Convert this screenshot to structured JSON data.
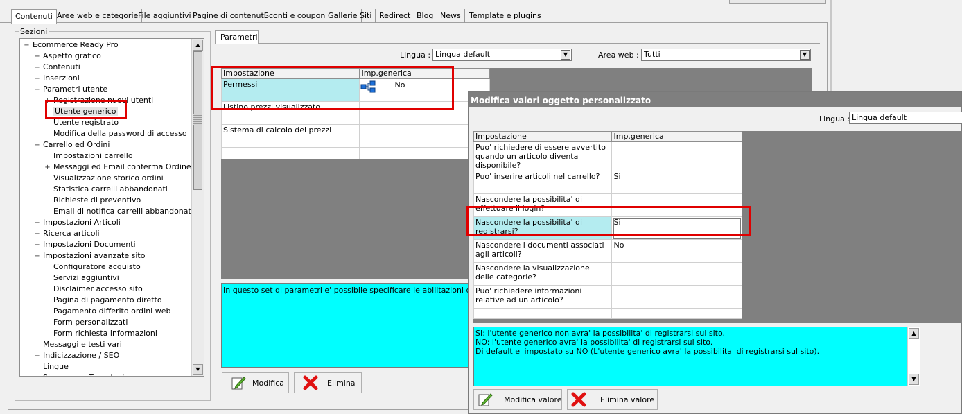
{
  "tabs": [
    "Contenuti",
    "Aree web e categorie",
    "File aggiuntivi",
    "Pagine di contenuti",
    "Sconti e coupon",
    "Gallerie",
    "Siti",
    "Redirect",
    "Blog",
    "News",
    "Template e plugins"
  ],
  "sections": {
    "legend": "Sezioni",
    "tree": [
      {
        "label": "Ecommerce Ready Pro",
        "exp": "−"
      },
      {
        "label": "Aspetto grafico",
        "exp": "+"
      },
      {
        "label": "Contenuti",
        "exp": "+"
      },
      {
        "label": "Inserzioni",
        "exp": "+"
      },
      {
        "label": "Parametri utente",
        "exp": "−"
      },
      {
        "label": "Registrazione nuovi utenti",
        "exp": "+"
      },
      {
        "label": "Utente generico",
        "exp": ""
      },
      {
        "label": "Utente registrato",
        "exp": ""
      },
      {
        "label": "Modifica della password di accesso",
        "exp": ""
      },
      {
        "label": "Carrello ed Ordini",
        "exp": "−"
      },
      {
        "label": "Impostazioni carrello",
        "exp": ""
      },
      {
        "label": "Messaggi ed Email conferma Ordine",
        "exp": "+"
      },
      {
        "label": "Visualizzazione storico ordini",
        "exp": ""
      },
      {
        "label": "Statistica carrelli abbandonati",
        "exp": ""
      },
      {
        "label": "Richieste di preventivo",
        "exp": ""
      },
      {
        "label": "Email di notifica carrelli abbandonati",
        "exp": ""
      },
      {
        "label": "Impostazioni Articoli",
        "exp": "+"
      },
      {
        "label": "Ricerca articoli",
        "exp": "+"
      },
      {
        "label": "Impostazioni Documenti",
        "exp": "+"
      },
      {
        "label": "Impostazioni avanzate sito",
        "exp": "−"
      },
      {
        "label": "Configuratore acquisto",
        "exp": ""
      },
      {
        "label": "Servizi aggiuntivi",
        "exp": ""
      },
      {
        "label": "Disclaimer accesso sito",
        "exp": ""
      },
      {
        "label": "Pagina di pagamento diretto",
        "exp": ""
      },
      {
        "label": "Pagamento differito ordini web",
        "exp": ""
      },
      {
        "label": "Form personalizzati",
        "exp": ""
      },
      {
        "label": "Form richiesta informazioni",
        "exp": ""
      },
      {
        "label": "Messaggi e testi vari",
        "exp": ""
      },
      {
        "label": "Indicizzazione / SEO",
        "exp": "+"
      },
      {
        "label": "Lingue",
        "exp": ""
      },
      {
        "label": "Sicurezza e Tecnologia",
        "exp": "+"
      }
    ]
  },
  "params": {
    "tab": "Parametri",
    "lingua_label": "Lingua :",
    "lingua_value": "Lingua default",
    "area_label": "Area web :",
    "area_value": "Tutti",
    "headers": [
      "Impostazione",
      "Imp.generica"
    ],
    "rows": [
      {
        "name": "Permessi",
        "value": "No"
      },
      {
        "name": "Listino prezzi visualizzato",
        "value": ""
      },
      {
        "name": "Sistema di calcolo dei prezzi",
        "value": ""
      }
    ],
    "description": "In questo set di parametri e' possibile specificare le abilitazioni dell'utente generico",
    "btn_modifica": "Modifica",
    "btn_elimina": "Elimina"
  },
  "dialog": {
    "title": "Modifica valori oggetto personalizzato",
    "lingua_label": "Lingua :",
    "lingua_value": "Lingua default",
    "headers": [
      "Impostazione",
      "Imp.generica"
    ],
    "rows": [
      {
        "name": "Puo' richiedere di essere avvertito quando un articolo diventa disponibile?",
        "value": ""
      },
      {
        "name": "Puo' inserire articoli nel carrello?",
        "value": "Si"
      },
      {
        "name": "Nascondere la possibilita' di effettuare il login?",
        "value": ""
      },
      {
        "name": "Nascondere la possibilita' di registrarsi?",
        "value": "Si"
      },
      {
        "name": "Nascondere i documenti associati agli articoli?",
        "value": "No"
      },
      {
        "name": "Nascondere la visualizzazione delle categorie?",
        "value": ""
      },
      {
        "name": "Puo' richiedere informazioni relative ad un articolo?",
        "value": ""
      }
    ],
    "description_lines": [
      "SI: l'utente generico non avra' la possibilita' di registrarsi sul sito.",
      "NO: l'utente  generico avra' la possibilita' di registrarsi sul sito.",
      "Di default e' impostato su NO (L'utente  generico avra' la possibilita' di registrarsi sul sito)."
    ],
    "btn_modifica": "Modifica valore",
    "btn_elimina": "Elimina valore"
  }
}
